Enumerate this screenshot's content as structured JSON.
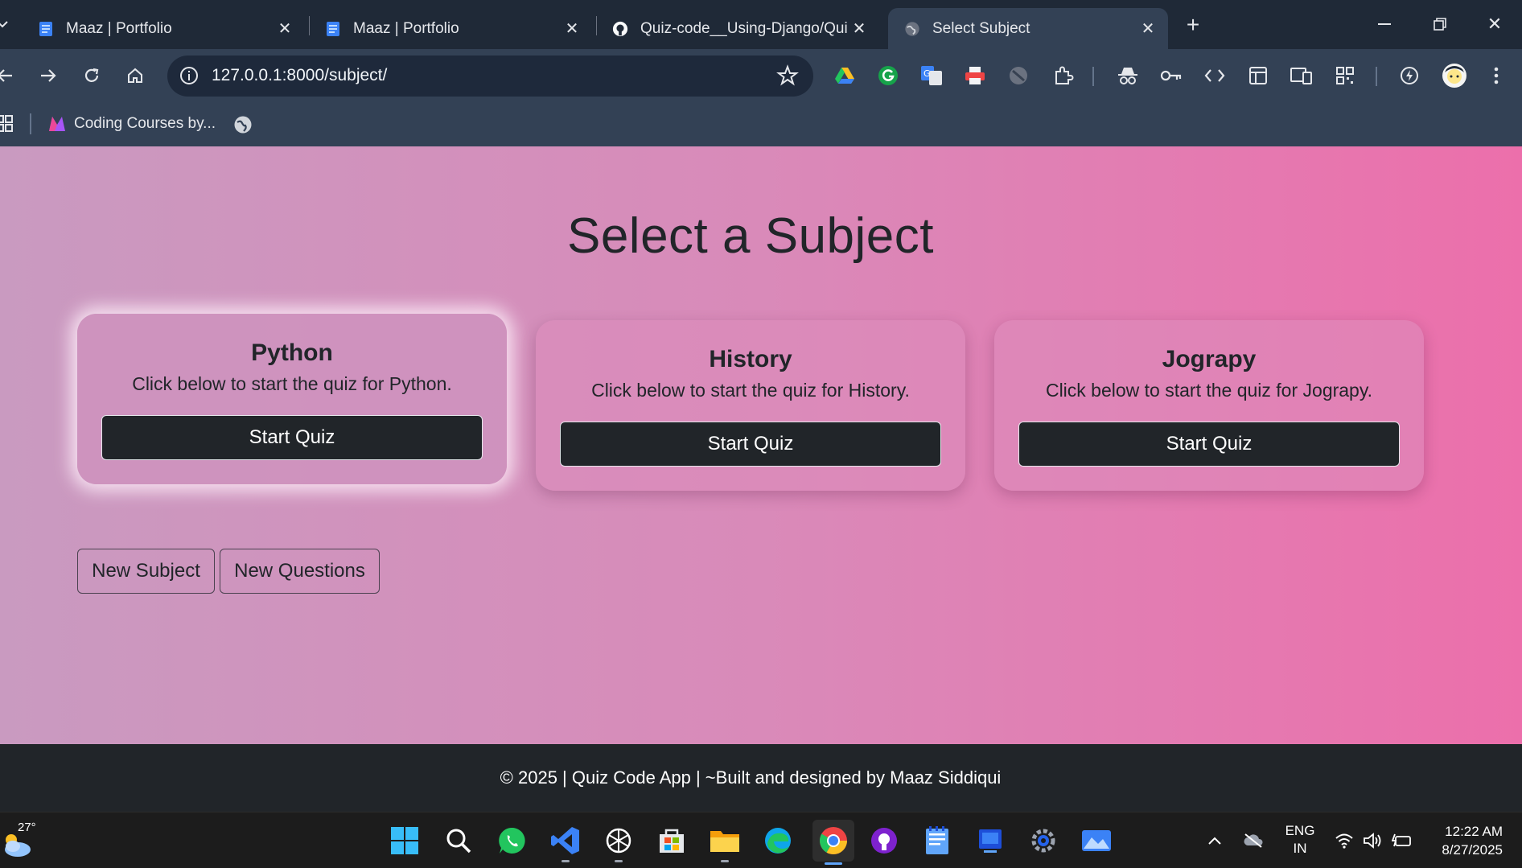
{
  "browser": {
    "tabs": [
      {
        "title": "Maaz | Portfolio",
        "active": false
      },
      {
        "title": "Maaz | Portfolio",
        "active": false
      },
      {
        "title": "Quiz-code__Using-Django/Quiz",
        "active": false
      },
      {
        "title": "Select Subject",
        "active": true
      }
    ],
    "url": "127.0.0.1:8000/subject/",
    "bookmarks": [
      {
        "label": "Coding Courses by..."
      }
    ]
  },
  "page": {
    "heading": "Select a Subject",
    "cards": [
      {
        "title": "Python",
        "description": "Click below to start the quiz for Python.",
        "button": "Start Quiz"
      },
      {
        "title": "History",
        "description": "Click below to start the quiz for History.",
        "button": "Start Quiz"
      },
      {
        "title": "Jograpy",
        "description": "Click below to start the quiz for Jograpy.",
        "button": "Start Quiz"
      }
    ],
    "actions": {
      "new_subject": "New Subject",
      "new_questions": "New Questions"
    },
    "footer": "© 2025 | Quiz Code App | ~Built and designed by Maaz Siddiqui"
  },
  "taskbar": {
    "weather_temp": "27°",
    "language": "ENG",
    "region": "IN",
    "time": "12:22 AM",
    "date": "8/27/2025"
  },
  "colors": {
    "page_gradient_start": "#c99ac0",
    "page_gradient_end": "#ec6fab",
    "button_dark": "#212529",
    "browser_chrome": "#334155"
  }
}
